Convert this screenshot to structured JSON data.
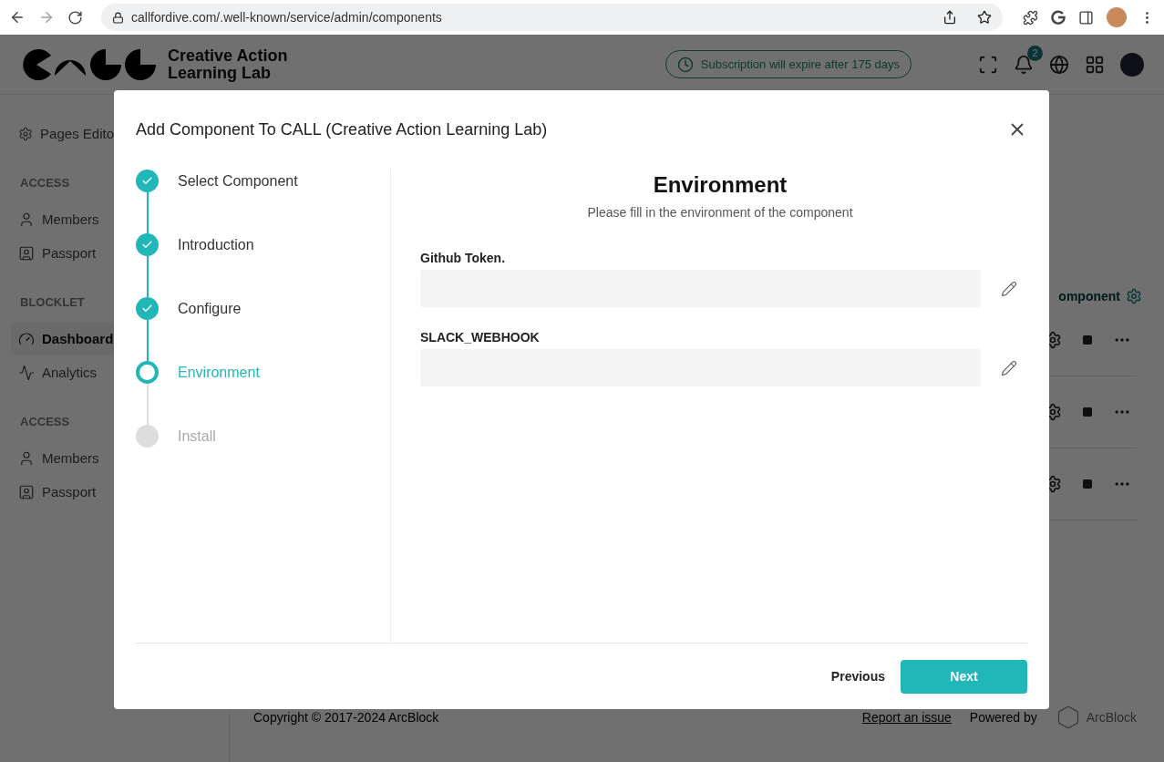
{
  "browser": {
    "url": "callfordive.com/.well-known/service/admin/components"
  },
  "header": {
    "brand_text": "Creative Action Learning Lab",
    "subscription": "Subscription will expire after 175 days",
    "notification_count": "2"
  },
  "sidebar": {
    "sections": [
      {
        "items": [
          {
            "label": "Pages Edito",
            "kind": "settings",
            "selected": false
          }
        ]
      },
      {
        "heading": "ACCESS",
        "items": [
          {
            "label": "Members",
            "kind": "user",
            "selected": false
          },
          {
            "label": "Passport",
            "kind": "passport",
            "selected": false
          }
        ]
      },
      {
        "heading": "BLOCKLET",
        "items": [
          {
            "label": "Dashboard",
            "kind": "dashboard",
            "selected": true
          },
          {
            "label": "Analytics",
            "kind": "analytics",
            "selected": false
          }
        ]
      },
      {
        "heading": "ACCESS",
        "items": [
          {
            "label": "Members",
            "kind": "user",
            "selected": false
          },
          {
            "label": "Passport",
            "kind": "passport",
            "selected": false
          }
        ]
      }
    ]
  },
  "main": {
    "title_fragment": "omponent"
  },
  "footer": {
    "copyright": "Copyright © 2017-2024  ArcBlock",
    "report_link": "Report an issue",
    "powered_by": "Powered by",
    "brand": "ArcBlock"
  },
  "dialog": {
    "title": "Add Component To CALL (Creative Action Learning Lab)",
    "steps": [
      {
        "label": "Select Component",
        "completed": true,
        "current": false
      },
      {
        "label": "Introduction",
        "completed": true,
        "current": false
      },
      {
        "label": "Configure",
        "completed": true,
        "current": false
      },
      {
        "label": "Environment",
        "completed": false,
        "current": true
      },
      {
        "label": "Install",
        "completed": false,
        "current": false
      }
    ],
    "section_title": "Environment",
    "section_subtitle": "Please fill in the environment of the component",
    "fields": [
      {
        "label": "Github Token."
      },
      {
        "label": "SLACK_WEBHOOK"
      }
    ],
    "buttons": {
      "previous": "Previous",
      "next": "Next"
    }
  }
}
